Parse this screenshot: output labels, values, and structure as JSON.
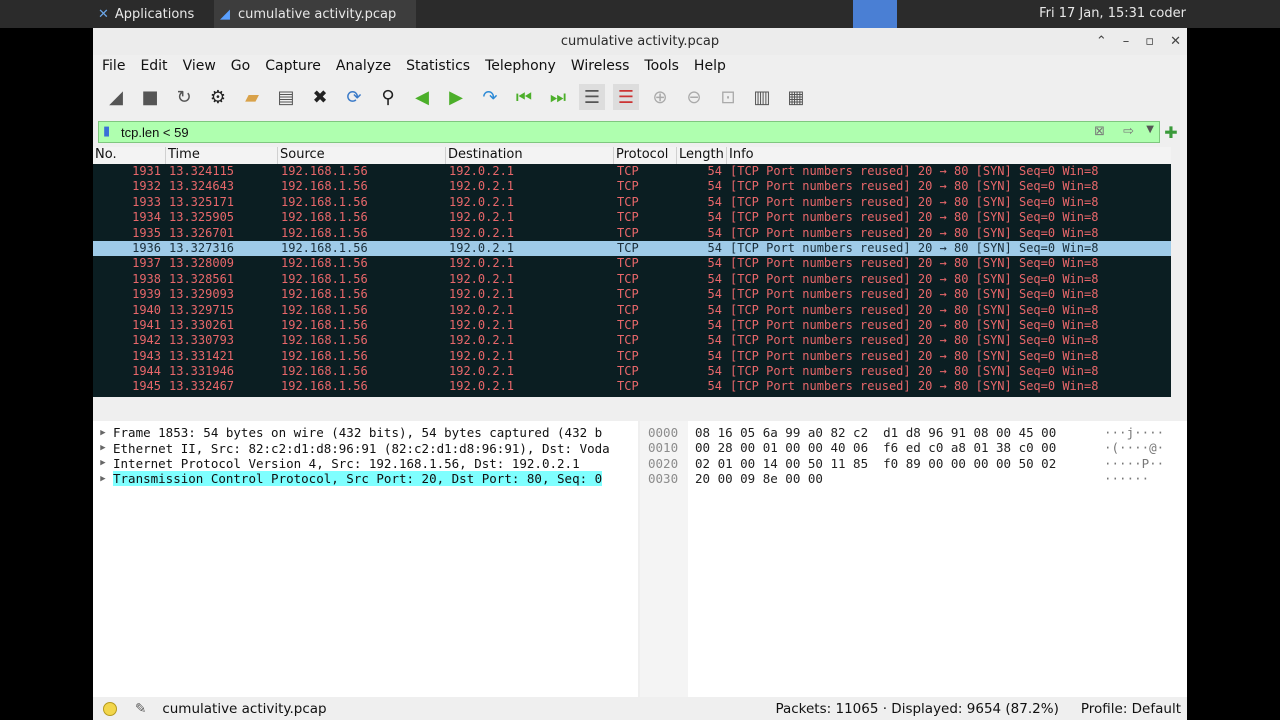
{
  "taskbar": {
    "apps_label": "Applications",
    "task_title": "cumulative activity.pcap",
    "clock": "Fri 17 Jan, 15:31 coder"
  },
  "window": {
    "title": "cumulative activity.pcap"
  },
  "menu": [
    "File",
    "Edit",
    "View",
    "Go",
    "Capture",
    "Analyze",
    "Statistics",
    "Telephony",
    "Wireless",
    "Tools",
    "Help"
  ],
  "toolbar_icons": [
    "shark-fin-start-icon",
    "stop-icon",
    "restart-icon",
    "capture-options-icon",
    "open-file-icon",
    "save-file-icon",
    "close-file-icon",
    "reload-icon",
    "find-icon",
    "back-icon",
    "forward-icon",
    "goto-packet-icon",
    "first-packet-icon",
    "last-packet-icon",
    "autoscroll-icon",
    "colorize-icon",
    "zoom-in-icon",
    "zoom-out-icon",
    "normal-size-icon",
    "resize-columns-icon",
    "layout-icon"
  ],
  "filter": {
    "value": "tcp.len < 59"
  },
  "columns": [
    "No.",
    "Time",
    "Source",
    "Destination",
    "Protocol",
    "Length",
    "Info"
  ],
  "packets": [
    {
      "no": "1931",
      "time": "13.324115",
      "src": "192.168.1.56",
      "dst": "192.0.2.1",
      "proto": "TCP",
      "len": "54",
      "info": "[TCP Port numbers reused] 20 → 80 [SYN] Seq=0 Win=8"
    },
    {
      "no": "1932",
      "time": "13.324643",
      "src": "192.168.1.56",
      "dst": "192.0.2.1",
      "proto": "TCP",
      "len": "54",
      "info": "[TCP Port numbers reused] 20 → 80 [SYN] Seq=0 Win=8"
    },
    {
      "no": "1933",
      "time": "13.325171",
      "src": "192.168.1.56",
      "dst": "192.0.2.1",
      "proto": "TCP",
      "len": "54",
      "info": "[TCP Port numbers reused] 20 → 80 [SYN] Seq=0 Win=8"
    },
    {
      "no": "1934",
      "time": "13.325905",
      "src": "192.168.1.56",
      "dst": "192.0.2.1",
      "proto": "TCP",
      "len": "54",
      "info": "[TCP Port numbers reused] 20 → 80 [SYN] Seq=0 Win=8"
    },
    {
      "no": "1935",
      "time": "13.326701",
      "src": "192.168.1.56",
      "dst": "192.0.2.1",
      "proto": "TCP",
      "len": "54",
      "info": "[TCP Port numbers reused] 20 → 80 [SYN] Seq=0 Win=8"
    },
    {
      "no": "1936",
      "time": "13.327316",
      "src": "192.168.1.56",
      "dst": "192.0.2.1",
      "proto": "TCP",
      "len": "54",
      "info": "[TCP Port numbers reused] 20 → 80 [SYN] Seq=0 Win=8",
      "selected": true
    },
    {
      "no": "1937",
      "time": "13.328009",
      "src": "192.168.1.56",
      "dst": "192.0.2.1",
      "proto": "TCP",
      "len": "54",
      "info": "[TCP Port numbers reused] 20 → 80 [SYN] Seq=0 Win=8"
    },
    {
      "no": "1938",
      "time": "13.328561",
      "src": "192.168.1.56",
      "dst": "192.0.2.1",
      "proto": "TCP",
      "len": "54",
      "info": "[TCP Port numbers reused] 20 → 80 [SYN] Seq=0 Win=8"
    },
    {
      "no": "1939",
      "time": "13.329093",
      "src": "192.168.1.56",
      "dst": "192.0.2.1",
      "proto": "TCP",
      "len": "54",
      "info": "[TCP Port numbers reused] 20 → 80 [SYN] Seq=0 Win=8"
    },
    {
      "no": "1940",
      "time": "13.329715",
      "src": "192.168.1.56",
      "dst": "192.0.2.1",
      "proto": "TCP",
      "len": "54",
      "info": "[TCP Port numbers reused] 20 → 80 [SYN] Seq=0 Win=8"
    },
    {
      "no": "1941",
      "time": "13.330261",
      "src": "192.168.1.56",
      "dst": "192.0.2.1",
      "proto": "TCP",
      "len": "54",
      "info": "[TCP Port numbers reused] 20 → 80 [SYN] Seq=0 Win=8"
    },
    {
      "no": "1942",
      "time": "13.330793",
      "src": "192.168.1.56",
      "dst": "192.0.2.1",
      "proto": "TCP",
      "len": "54",
      "info": "[TCP Port numbers reused] 20 → 80 [SYN] Seq=0 Win=8"
    },
    {
      "no": "1943",
      "time": "13.331421",
      "src": "192.168.1.56",
      "dst": "192.0.2.1",
      "proto": "TCP",
      "len": "54",
      "info": "[TCP Port numbers reused] 20 → 80 [SYN] Seq=0 Win=8"
    },
    {
      "no": "1944",
      "time": "13.331946",
      "src": "192.168.1.56",
      "dst": "192.0.2.1",
      "proto": "TCP",
      "len": "54",
      "info": "[TCP Port numbers reused] 20 → 80 [SYN] Seq=0 Win=8"
    },
    {
      "no": "1945",
      "time": "13.332467",
      "src": "192.168.1.56",
      "dst": "192.0.2.1",
      "proto": "TCP",
      "len": "54",
      "info": "[TCP Port numbers reused] 20 → 80 [SYN] Seq=0 Win=8"
    }
  ],
  "details": [
    {
      "text": "Frame 1853: 54 bytes on wire (432 bits), 54 bytes captured (432 b"
    },
    {
      "text": "Ethernet II, Src: 82:c2:d1:d8:96:91 (82:c2:d1:d8:96:91), Dst: Voda"
    },
    {
      "text": "Internet Protocol Version 4, Src: 192.168.1.56, Dst: 192.0.2.1"
    },
    {
      "text": "Transmission Control Protocol, Src Port: 20, Dst Port: 80, Seq: 0",
      "highlight": true
    }
  ],
  "hex": {
    "offsets": [
      "0000",
      "0010",
      "0020",
      "0030"
    ],
    "bytes": [
      "08 16 05 6a 99 a0 82 c2  d1 d8 96 91 08 00 45 00",
      "00 28 00 01 00 00 40 06  f6 ed c0 a8 01 38 c0 00",
      "02 01 00 14 00 50 11 85  f0 89 00 00 00 00 50 02",
      "20 00 09 8e 00 00"
    ],
    "ascii": [
      "···j····",
      "·(····@·",
      "·····P··",
      "······"
    ]
  },
  "status": {
    "file": "cumulative activity.pcap",
    "packets": "Packets: 11065 · Displayed: 9654 (87.2%)",
    "profile": "Profile: Default"
  }
}
